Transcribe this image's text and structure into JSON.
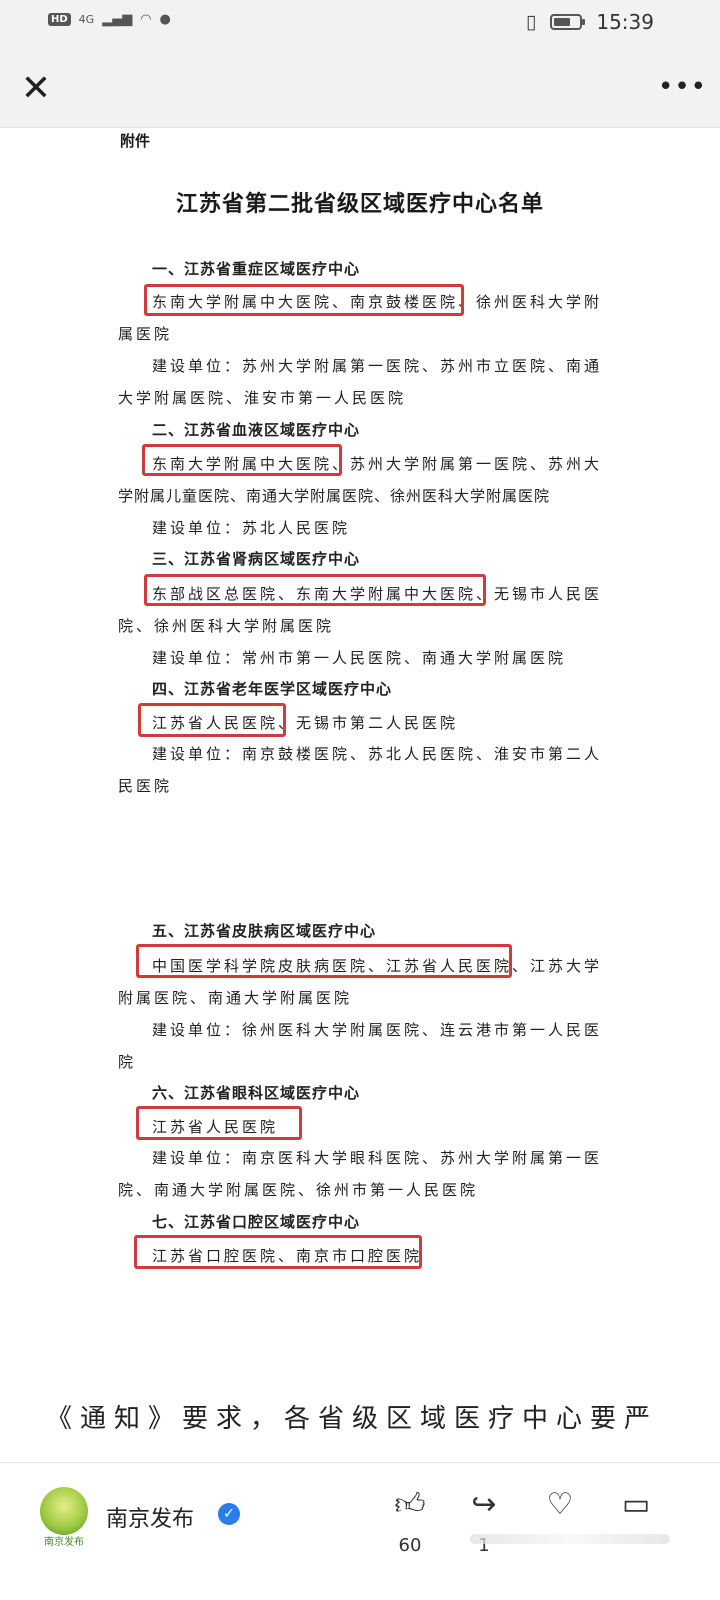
{
  "status_bar": {
    "network": "HD",
    "signal": "4G",
    "time": "15:39"
  },
  "header": {
    "close_icon": "close-icon",
    "more_icon": "more-icon"
  },
  "document": {
    "attachment_label": "附件",
    "title": "江苏省第二批省级区域医疗中心名单",
    "lines": [
      "一、江苏省重症区域医疗中心",
      "东南大学附属中大医院、南京鼓楼医院、徐州医科大学附",
      "属医院",
      "建设单位：苏州大学附属第一医院、苏州市立医院、南通",
      "大学附属医院、淮安市第一人民医院",
      "二、江苏省血液区域医疗中心",
      "东南大学附属中大医院、苏州大学附属第一医院、苏州大",
      "学附属儿童医院、南通大学附属医院、徐州医科大学附属医院",
      "建设单位：苏北人民医院",
      "三、江苏省肾病区域医疗中心",
      "东部战区总医院、东南大学附属中大医院、无锡市人民医",
      "院、徐州医科大学附属医院",
      "建设单位：常州市第一人民医院、南通大学附属医院",
      "四、江苏省老年医学区域医疗中心",
      "江苏省人民医院、无锡市第二人民医院",
      "建设单位：南京鼓楼医院、苏北人民医院、淮安市第二人",
      "民医院",
      "五、江苏省皮肤病区域医疗中心",
      "中国医学科学院皮肤病医院、江苏省人民医院、江苏大学",
      "附属医院、南通大学附属医院",
      "建设单位：徐州医科大学附属医院、连云港市第一人民医",
      "院",
      "六、江苏省眼科区域医疗中心",
      "江苏省人民医院",
      "建设单位：南京医科大学眼科医院、苏州大学附属第一医",
      "院、南通大学附属医院、徐州市第一人民医院",
      "七、江苏省口腔区域医疗中心",
      "江苏省口腔医院、南京市口腔医院"
    ]
  },
  "caption": "《通知》要求，各省级区域医疗中心要严",
  "footer": {
    "publisher": "南京发布",
    "avatar_text": "南京发布",
    "like_count": "60",
    "share_count": "1"
  },
  "colors": {
    "highlight": "#d23b3b",
    "verified": "#2b7de9"
  }
}
